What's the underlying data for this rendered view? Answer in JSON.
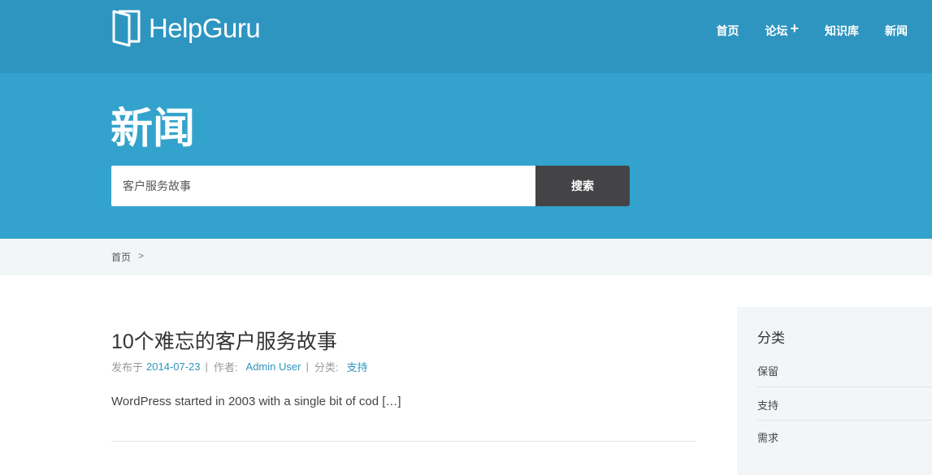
{
  "header": {
    "logo_text": "HelpGuru",
    "nav": [
      {
        "label": "首页"
      },
      {
        "label": "论坛",
        "plus": "+"
      },
      {
        "label": "知识库"
      },
      {
        "label": "新闻"
      }
    ]
  },
  "hero": {
    "title": "新闻",
    "search": {
      "value": "客户服务故事",
      "button_label": "搜索"
    }
  },
  "breadcrumb": {
    "home": "首页",
    "separator": ">"
  },
  "post": {
    "title": "10个难忘的客户服务故事",
    "meta": {
      "posted_label": "发布于",
      "date": "2014-07-23",
      "author_label": "作者:",
      "author": "Admin User",
      "category_label": "分类:",
      "category": "支持",
      "pipe": "|"
    },
    "excerpt": "WordPress started in 2003 with a single bit of cod […]"
  },
  "sidebar": {
    "title": "分类",
    "items": [
      {
        "label": "保留"
      },
      {
        "label": "支持"
      },
      {
        "label": "需求"
      }
    ]
  },
  "colors": {
    "topbar": "#2e95c0",
    "hero": "#33a3cd",
    "search_button": "#444446",
    "link": "#2e95c0",
    "light_bg": "#f2f6f8"
  }
}
